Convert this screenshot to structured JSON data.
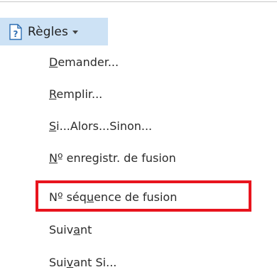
{
  "rules_button": {
    "label": "Règles",
    "icon": "rules-document-question-icon",
    "state_color": "#cde2f5"
  },
  "menu": {
    "items": [
      {
        "pre": "",
        "u": "D",
        "post": "emander..."
      },
      {
        "pre": "",
        "u": "R",
        "post": "emplir..."
      },
      {
        "pre": "",
        "u": "S",
        "post": "i...Alors...Sinon..."
      },
      {
        "pre": "",
        "u": "N",
        "post": "º enregistr. de fusion"
      },
      {
        "pre": "Nº séq",
        "u": "u",
        "post": "ence de fusion"
      },
      {
        "pre": "Suiv",
        "u": "a",
        "post": "nt"
      },
      {
        "pre": "Sui",
        "u": "v",
        "post": "ant Si..."
      }
    ],
    "highlighted_index": 4,
    "highlight_color": "#e8141e"
  }
}
